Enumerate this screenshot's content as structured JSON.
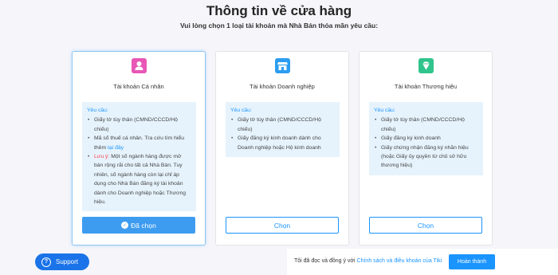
{
  "header": {
    "title": "Thông tin về cửa hàng",
    "subtitle": "Vui lòng chọn 1 loại tài khoản mà Nhà Bán thỏa mãn yêu cầu:"
  },
  "cards": [
    {
      "title": "Tài khoản Cá nhân",
      "icon": "person-icon",
      "icon_color": "#e856b6",
      "req_title": "Yêu cầu:",
      "items": [
        "Giấy tờ tùy thân (CMND/CCCD/Hộ chiếu)",
        "Mã số thuế cá nhân. Tra cứu tìm hiểu thêm",
        "Một số ngành hàng được mở bán rộng rãi cho tất cả Nhà Bán. Tuy nhiên, số ngành hàng còn lại chỉ áp dụng cho Nhà Bán đăng ký tài khoản dành cho Doanh nghiệp hoặc Thương hiệu."
      ],
      "link_text": "tại đây",
      "warn_label": "Lưu ý:",
      "button": "Đã chọn",
      "selected": true
    },
    {
      "title": "Tài khoản Doanh nghiệp",
      "icon": "store-icon",
      "icon_color": "#2c9df0",
      "req_title": "Yêu cầu:",
      "items": [
        "Giấy tờ tùy thân (CMND/CCCD/Hộ chiếu)",
        "Giấy đăng ký kinh doanh dành cho Doanh nghiệp hoặc Hộ kinh doanh"
      ],
      "button": "Chọn",
      "selected": false
    },
    {
      "title": "Tài khoản Thương hiệu",
      "icon": "diamond-icon",
      "icon_color": "#30c48d",
      "req_title": "Yêu cầu:",
      "items": [
        "Giấy tờ tùy thân (CMND/CCCD/Hộ chiếu)",
        "Giấy đăng ký kinh doanh",
        "Giấy chứng nhận đăng ký nhãn hiệu (hoặc Giấy ủy quyền từ chủ sở hữu thương hiệu)"
      ],
      "button": "Chọn",
      "selected": false
    }
  ],
  "footer": {
    "support": "Support",
    "agree_text": "Tôi đã đọc và đồng ý với",
    "policy_link": "Chính sách và điều khoản của Tiki",
    "done": "Hoàn thành"
  }
}
